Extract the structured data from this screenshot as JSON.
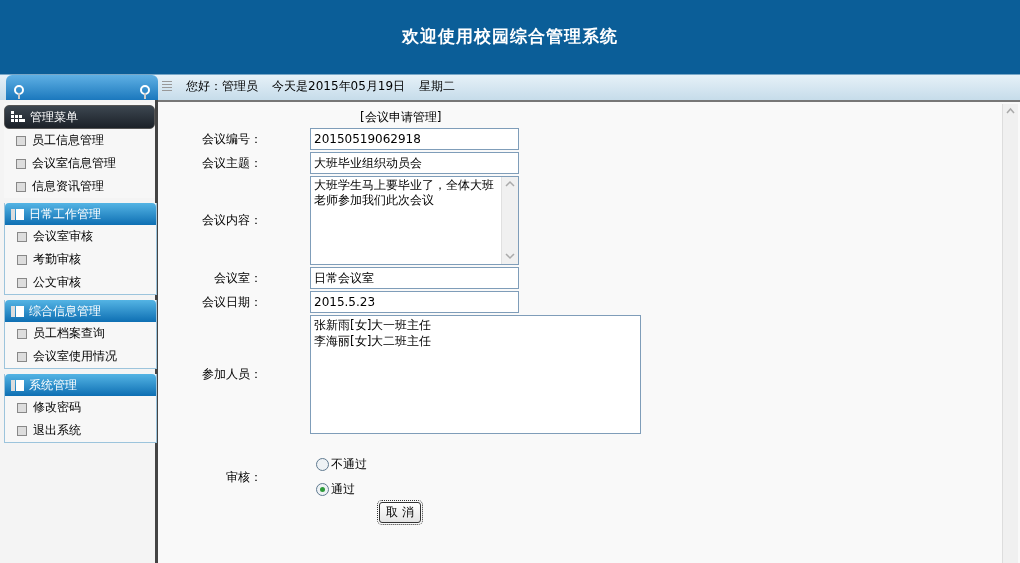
{
  "header": {
    "title": "欢迎使用校园综合管理系统"
  },
  "info_bar": {
    "greeting": "您好：管理员",
    "date": "今天是2015年05月19日",
    "weekday": "星期二"
  },
  "sidebar": {
    "groups": [
      {
        "kind": "dark",
        "title": "管理菜单",
        "items": [
          "员工信息管理",
          "会议室信息管理",
          "信息资讯管理"
        ]
      },
      {
        "kind": "blue",
        "title": "日常工作管理",
        "items": [
          "会议室审核",
          "考勤审核",
          "公文审核"
        ]
      },
      {
        "kind": "blue",
        "title": "综合信息管理",
        "items": [
          "员工档案查询",
          "会议室使用情况"
        ]
      },
      {
        "kind": "blue",
        "title": "系统管理",
        "items": [
          "修改密码",
          "退出系统"
        ]
      }
    ]
  },
  "form": {
    "title": "[会议申请管理]",
    "fields": [
      {
        "kind": "input",
        "label": "会议编号：",
        "value": "20150519062918"
      },
      {
        "kind": "input",
        "label": "会议主题：",
        "value": "大班毕业组织动员会"
      },
      {
        "kind": "textarea",
        "label": "会议内容：",
        "value": "大班学生马上要毕业了，全体大班老师参加我们此次会议"
      },
      {
        "kind": "input",
        "label": "会议室：",
        "value": "日常会议室"
      },
      {
        "kind": "input",
        "label": "会议日期：",
        "value": "2015.5.23"
      },
      {
        "kind": "list",
        "label": "参加人员：",
        "lines": [
          "张新雨[女]大一班主任",
          "李海丽[女]大二班主任"
        ]
      }
    ],
    "review": {
      "label": "审核：",
      "options": [
        {
          "label": "不通过",
          "selected": false
        },
        {
          "label": "通过",
          "selected": true
        }
      ]
    },
    "button": "取 消"
  }
}
